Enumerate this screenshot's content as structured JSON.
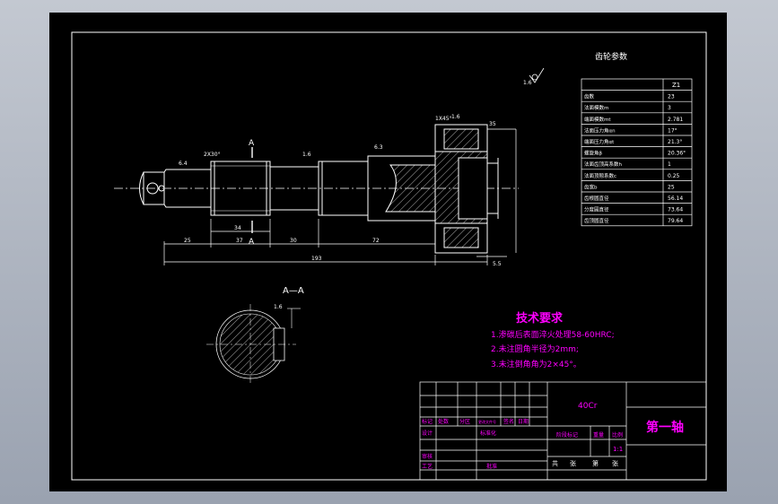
{
  "gear_params": {
    "title": "齿轮参数",
    "header": "Z1",
    "rows": [
      {
        "label": "齿数",
        "value": "23"
      },
      {
        "label": "法面模数m",
        "value": "3"
      },
      {
        "label": "端面模数mt",
        "value": "2.781"
      },
      {
        "label": "法面压力角αn",
        "value": "17°"
      },
      {
        "label": "端面压力角αt",
        "value": "21.3°"
      },
      {
        "label": "螺旋角β",
        "value": "20.36°"
      },
      {
        "label": "法面齿顶高系数h",
        "value": "1"
      },
      {
        "label": "法面顶隙系数c",
        "value": "0.25"
      },
      {
        "label": "齿宽b",
        "value": "25"
      },
      {
        "label": "齿根圆直径",
        "value": "56.14"
      },
      {
        "label": "分度圆直径",
        "value": "73.64"
      },
      {
        "label": "齿顶圆直径",
        "value": "79.64"
      }
    ]
  },
  "tech_req": {
    "title": "技术要求",
    "items": [
      "1.渗碳后表面淬火处理58-60HRC;",
      "2.未注圆角半径为2mm;",
      "3.未注倒角角为2×45°。"
    ]
  },
  "dims": {
    "len_25": "25",
    "len_37": "37",
    "len_30": "30",
    "len_72": "72",
    "len_193": "193",
    "len_34": "34",
    "len_35": "35",
    "len_5_5": "5.5",
    "chamfer_top": "1X45°",
    "chamfer_left": "2X30°",
    "rough_a": "6.4",
    "rough_b": "1.6",
    "rough_c": "6.3",
    "rough_d": "1.6",
    "rough_e": "1.6",
    "rough_f": "1.6"
  },
  "section": {
    "label_top": "A",
    "label_bottom": "A",
    "title": "A—A"
  },
  "title_block": {
    "material": "40Cr",
    "part_name": "第一轴",
    "scale": "1:1",
    "row_labels": [
      "标记",
      "处数",
      "分区",
      "更改文件号",
      "签名",
      "日期"
    ],
    "design": "设计",
    "standard": "标准化",
    "stage_label": "阶段标记",
    "weight": "重量",
    "scale_label": "比例",
    "review": "审核",
    "process": "工艺",
    "approve": "批准",
    "total": "共",
    "sheet": "张",
    "page": "第",
    "page_sheet": "张"
  },
  "colors": {
    "background": "#000000",
    "lines": "#ffffff",
    "text": "#ffffff",
    "accent": "#ff00ff"
  }
}
